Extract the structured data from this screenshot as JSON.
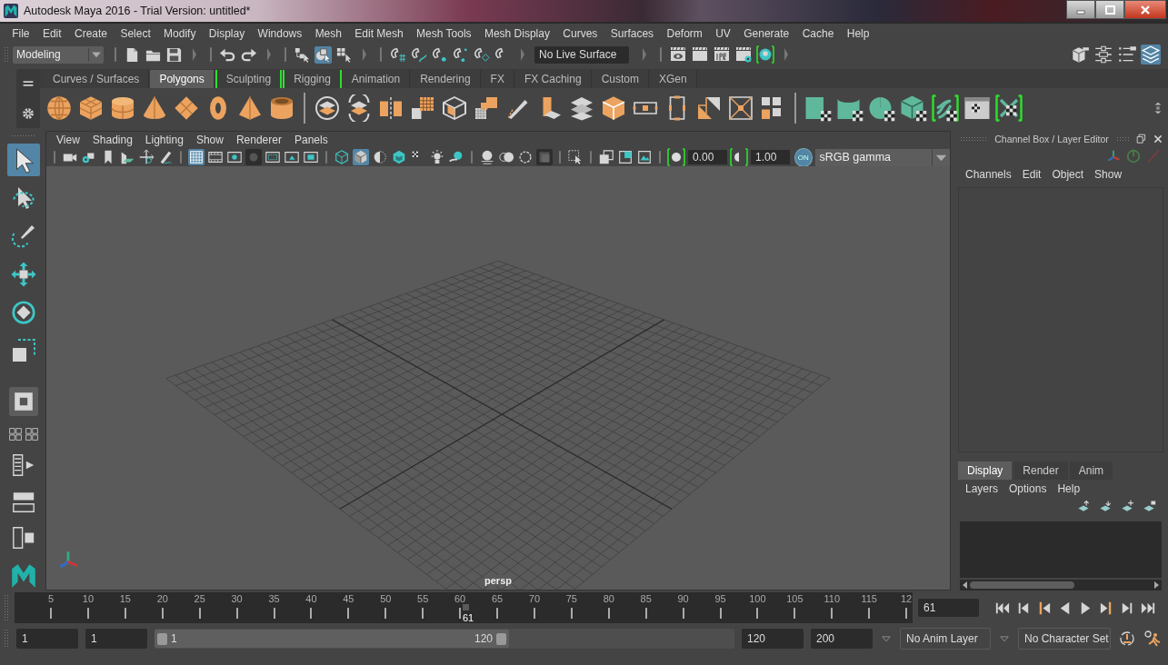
{
  "window": {
    "title": "Autodesk Maya 2016 - Trial Version: untitled*"
  },
  "menu_bar": [
    "File",
    "Edit",
    "Create",
    "Select",
    "Modify",
    "Display",
    "Windows",
    "Mesh",
    "Edit Mesh",
    "Mesh Tools",
    "Mesh Display",
    "Curves",
    "Surfaces",
    "Deform",
    "UV",
    "Generate",
    "Cache",
    "Help"
  ],
  "status_line": {
    "menu_set": "Modeling",
    "groups": [
      [
        {
          "kind": "new-file",
          "selected": false
        },
        {
          "kind": "open-folder",
          "selected": false
        },
        {
          "kind": "save",
          "selected": false
        }
      ],
      [
        {
          "kind": "undo",
          "selected": false
        },
        {
          "kind": "redo",
          "selected": false
        }
      ],
      [
        {
          "kind": "select-hierarchy",
          "selected": false
        },
        {
          "kind": "select-object",
          "selected": true
        },
        {
          "kind": "select-component",
          "selected": false
        }
      ],
      [
        {
          "kind": "snap-grid",
          "selected": false
        },
        {
          "kind": "snap-curve",
          "selected": false
        },
        {
          "kind": "snap-point",
          "selected": false
        },
        {
          "kind": "snap-view",
          "selected": false
        },
        {
          "kind": "snap-surface",
          "selected": false
        },
        {
          "kind": "magnet",
          "selected": false
        }
      ]
    ],
    "live_surface": "No Live Surface",
    "render_tools": [
      {
        "kind": "render-view",
        "selected": false
      },
      {
        "kind": "clapper",
        "selected": false
      },
      {
        "kind": "ipr",
        "selected": false
      },
      {
        "kind": "render-settings",
        "selected": false
      },
      {
        "kind": "hypershade",
        "selected": false
      }
    ],
    "panel_toggles": [
      {
        "kind": "modeling-toolkit",
        "selected": false
      },
      {
        "kind": "attribute-editor",
        "selected": false
      },
      {
        "kind": "tool-settings",
        "selected": false
      },
      {
        "kind": "layers",
        "selected": true
      }
    ]
  },
  "shelf_tabs": [
    {
      "label": "Curves / Surfaces",
      "selected": false,
      "bracketed": false
    },
    {
      "label": "Polygons",
      "selected": true,
      "bracketed": false
    },
    {
      "label": "Sculpting",
      "selected": false,
      "bracketed": true
    },
    {
      "label": "Rigging",
      "selected": false,
      "bracketed": true
    },
    {
      "label": "Animation",
      "selected": false,
      "bracketed": false
    },
    {
      "label": "Rendering",
      "selected": false,
      "bracketed": false
    },
    {
      "label": "FX",
      "selected": false,
      "bracketed": false
    },
    {
      "label": "FX Caching",
      "selected": false,
      "bracketed": false
    },
    {
      "label": "Custom",
      "selected": false,
      "bracketed": false
    },
    {
      "label": "XGen",
      "selected": false,
      "bracketed": false
    }
  ],
  "toolbox": [
    {
      "kind": "select",
      "selected": true
    },
    {
      "kind": "lasso",
      "selected": false
    },
    {
      "kind": "paint-select",
      "selected": false
    },
    {
      "kind": "move",
      "selected": false
    },
    {
      "kind": "rotate",
      "selected": false
    },
    {
      "kind": "scale",
      "selected": false
    }
  ],
  "viewport": {
    "menus": [
      "View",
      "Shading",
      "Lighting",
      "Show",
      "Renderer",
      "Panels"
    ],
    "toolbar_groups": [
      [
        {
          "kind": "camera",
          "selected": false
        },
        {
          "kind": "camera-gear",
          "selected": false
        },
        {
          "kind": "bookmark",
          "selected": false
        },
        {
          "kind": "image-plane",
          "selected": false
        },
        {
          "kind": "pivot",
          "selected": false
        },
        {
          "kind": "pencil",
          "selected": false
        }
      ],
      [
        {
          "kind": "grid",
          "selected": true
        },
        {
          "kind": "film-gate",
          "selected": false
        },
        {
          "kind": "resolution-gate",
          "selected": false
        },
        {
          "kind": "gate-mask",
          "selected": true
        },
        {
          "kind": "field-chart",
          "selected": false
        },
        {
          "kind": "safe-action",
          "selected": false
        },
        {
          "kind": "safe-title",
          "selected": false
        }
      ],
      [
        {
          "kind": "wire-cube",
          "selected": false
        },
        {
          "kind": "shaded-cube",
          "selected": true
        },
        {
          "kind": "half-circle",
          "selected": false
        },
        {
          "kind": "textured-cube",
          "selected": false
        },
        {
          "kind": "checker",
          "selected": false
        },
        {
          "kind": "light",
          "selected": false
        },
        {
          "kind": "shadow",
          "selected": false
        }
      ],
      [
        {
          "kind": "occlusion",
          "selected": false
        },
        {
          "kind": "motion-blur",
          "selected": false
        },
        {
          "kind": "antialias",
          "selected": false
        },
        {
          "kind": "depth",
          "selected": true
        }
      ],
      [
        {
          "kind": "isolate",
          "selected": false
        }
      ],
      [
        {
          "kind": "xray",
          "selected": false
        },
        {
          "kind": "xray-joint",
          "selected": false
        },
        {
          "kind": "image",
          "selected": false
        }
      ]
    ],
    "exposure": "0.00",
    "gamma": "1.00",
    "color_management": {
      "label": "ON",
      "on": true
    },
    "view_transform": "sRGB gamma",
    "camera": "persp"
  },
  "channel_box": {
    "title": "Channel Box / Layer Editor",
    "menus": [
      "Channels",
      "Edit",
      "Object",
      "Show"
    ]
  },
  "layer_editor": {
    "tabs": [
      {
        "label": "Display",
        "selected": true
      },
      {
        "label": "Render",
        "selected": false
      },
      {
        "label": "Anim",
        "selected": false
      }
    ],
    "menus": [
      "Layers",
      "Options",
      "Help"
    ]
  },
  "time_slider": {
    "ticks": [
      "5",
      "10",
      "15",
      "20",
      "25",
      "30",
      "35",
      "40",
      "45",
      "50",
      "55",
      "60",
      "65",
      "70",
      "75",
      "80",
      "85",
      "90",
      "95",
      "100",
      "105",
      "110",
      "115",
      "12"
    ],
    "playhead": {
      "frame": "61",
      "level": 0.503
    },
    "current_frame": "61"
  },
  "range_slider": {
    "start": "1",
    "playback_start": "1",
    "range_start": "1",
    "range_end": "120",
    "playback_end": "120",
    "end": "200",
    "anim_layer": "No Anim Layer",
    "character_set": "No Character Set"
  }
}
